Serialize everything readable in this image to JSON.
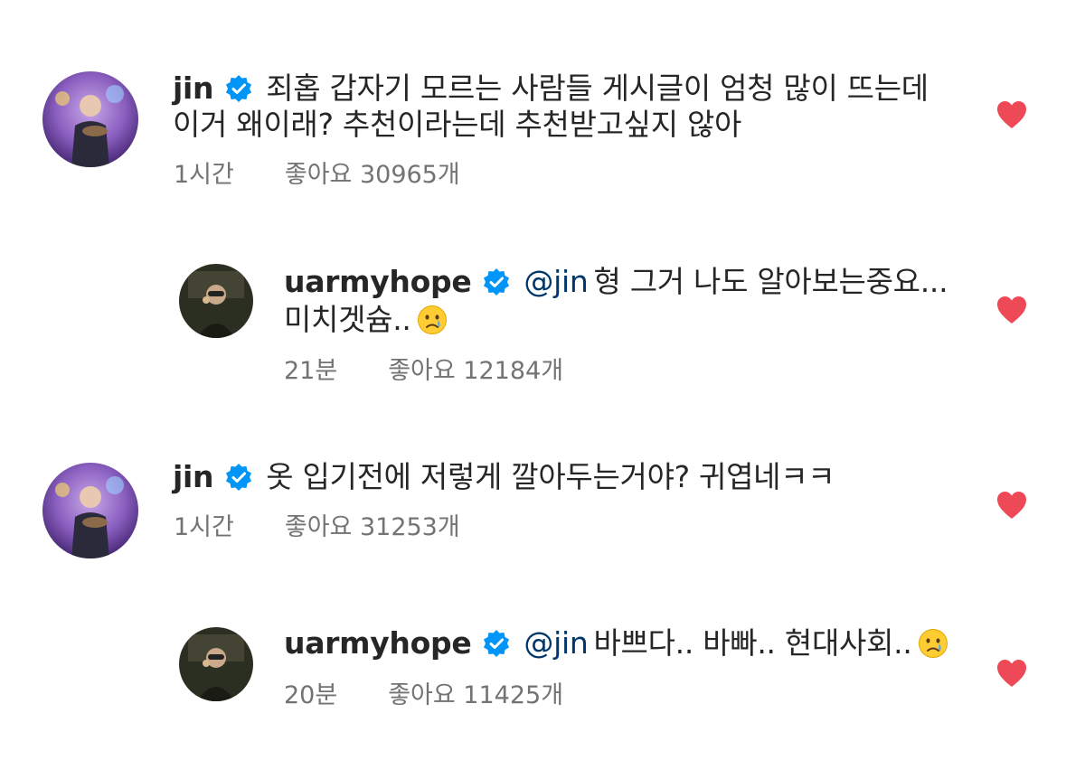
{
  "comments": [
    {
      "username": "jin",
      "lines": [
        "죄홉 갑자기 모르는 사람들 게시글이 엄청 많이 뜨는데",
        "이거 왜이래? 추천이라는데 추천받고싶지 않아"
      ],
      "time": "1시간",
      "likes": "좋아요 30965개"
    },
    {
      "username": "uarmyhope",
      "mention": "@jin",
      "lines": [
        "형 그거 나도 알아보는중요...",
        "미치겟슘.."
      ],
      "emoji": "crying-face-emoji",
      "time": "21분",
      "likes": "좋아요 12184개"
    },
    {
      "username": "jin",
      "lines": [
        "옷 입기전에 저렇게 깔아두는거야? 귀엽네ㅋㅋ"
      ],
      "time": "1시간",
      "likes": "좋아요 31253개"
    },
    {
      "username": "uarmyhope",
      "mention": "@jin",
      "lines": [
        "바쁘다.. 바빠.. 현대사회.."
      ],
      "emoji": "crying-face-emoji",
      "time": "20분",
      "likes": "좋아요 11425개"
    }
  ],
  "icons": {
    "verified": "verified-badge-icon",
    "like": "heart-icon"
  },
  "colors": {
    "verified": "#0095f6",
    "heart": "#ed4956",
    "mention": "#00376b",
    "meta": "#737373"
  }
}
